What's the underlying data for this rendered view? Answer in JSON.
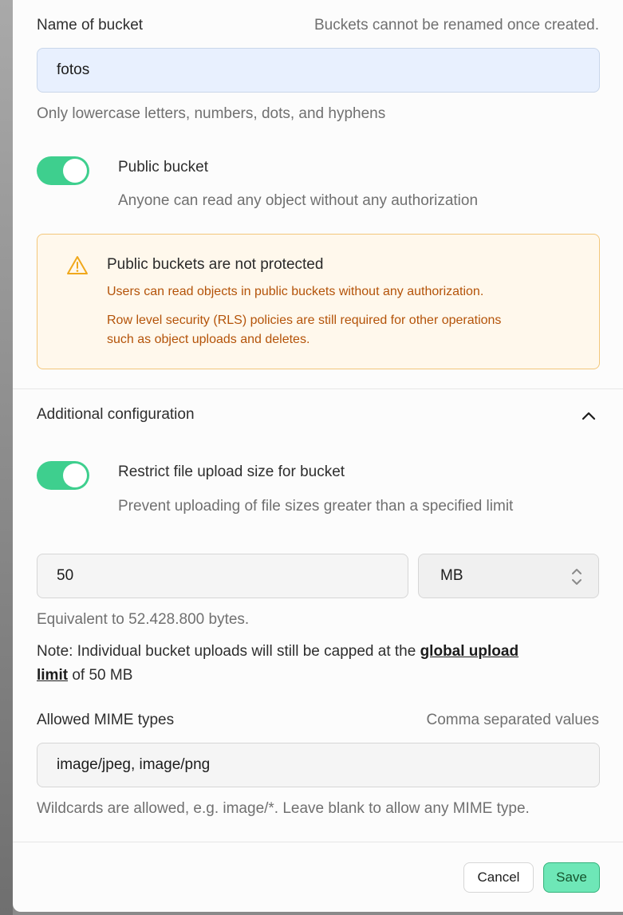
{
  "name_field": {
    "label": "Name of bucket",
    "hint": "Buckets cannot be renamed once created.",
    "value": "fotos",
    "help": "Only lowercase letters, numbers, dots, and hyphens"
  },
  "public_toggle": {
    "label": "Public bucket",
    "description": "Anyone can read any object without any authorization",
    "checked": true
  },
  "warning": {
    "title": "Public buckets are not protected",
    "line1": "Users can read objects in public buckets without any authorization.",
    "line2a": "Row level security (RLS) policies are still required for other operations",
    "line2b": "such as object uploads and deletes."
  },
  "additional": {
    "title": "Additional configuration",
    "restrict_toggle": {
      "label": "Restrict file upload size for bucket",
      "description": "Prevent uploading of file sizes greater than a specified limit",
      "checked": true
    },
    "size_value": "50",
    "size_unit": "MB",
    "equivalent": "Equivalent to 52.428.800 bytes.",
    "note_prefix": "Note: Individual bucket uploads will still be capped at the ",
    "note_link_1": "global upload",
    "note_link_2": "limit",
    "note_suffix": " of 50 MB",
    "mime_label": "Allowed MIME types",
    "mime_hint": "Comma separated values",
    "mime_value": "image/jpeg, image/png",
    "mime_help": "Wildcards are allowed, e.g. image/*. Leave blank to allow any MIME type."
  },
  "footer": {
    "cancel_label": "Cancel",
    "save_label": "Save"
  },
  "colors": {
    "toggle_on": "#3ecf8e",
    "save_bg": "#6ee7b7",
    "warning_text": "#b45309",
    "warning_border": "#f3c77a",
    "input_focus_bg": "#e8f0fe"
  }
}
